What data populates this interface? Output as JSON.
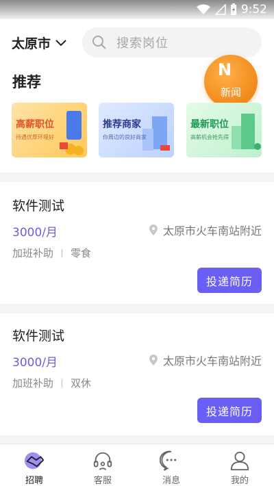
{
  "status_bar": {
    "time": "9:52"
  },
  "header": {
    "city": "太原市",
    "search_placeholder": "搜索岗位"
  },
  "recommend": {
    "title": "推荐",
    "news_badge": {
      "letter": "N",
      "label": "新闻"
    },
    "banners": [
      {
        "title": "高薪职位",
        "subtitle": "待遇优厚环境好"
      },
      {
        "title": "推荐商家",
        "subtitle": "你周边的良好商家"
      },
      {
        "title": "最新职位",
        "subtitle": "高薪机会抢先得"
      }
    ]
  },
  "jobs": [
    {
      "title": "软件测试",
      "salary": "3000/月",
      "location": "太原市火车南站附近",
      "tags": [
        "加班补助",
        "零食"
      ],
      "apply_label": "投递简历"
    },
    {
      "title": "软件测试",
      "salary": "3000/月",
      "location": "太原市火车南站附近",
      "tags": [
        "加班补助",
        "双休"
      ],
      "apply_label": "投递简历"
    }
  ],
  "tabbar": [
    {
      "label": "招聘",
      "icon": "handshake-icon",
      "active": true
    },
    {
      "label": "客服",
      "icon": "headset-icon",
      "active": false
    },
    {
      "label": "消息",
      "icon": "chat-bubble-icon",
      "active": false
    },
    {
      "label": "我的",
      "icon": "user-icon",
      "active": false
    }
  ],
  "colors": {
    "accent": "#6a5ef5",
    "salary": "#6b5fd6",
    "badge": "#f08a1a"
  }
}
